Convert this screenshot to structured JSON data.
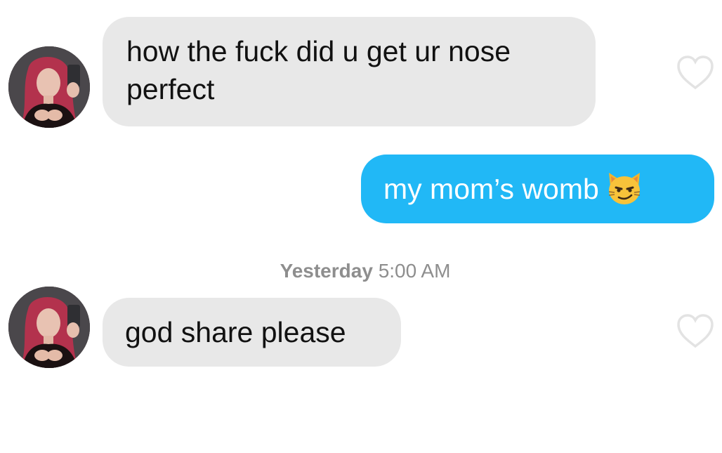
{
  "thread": {
    "top_cut_text": "",
    "messages": [
      {
        "direction": "received",
        "text": "how the fuck did u get ur nose perfect",
        "line1": "how the fuck did u get ur nose",
        "line2": "perfect"
      },
      {
        "direction": "sent",
        "text": "my mom’s womb",
        "emoji": "smiling-cat-with-smirk-icon"
      },
      {
        "direction": "received",
        "text": "god share please"
      }
    ],
    "timestamp": {
      "day": "Yesterday",
      "time": "5:00 AM"
    }
  },
  "colors": {
    "received_bubble": "#e8e8e8",
    "sent_bubble": "#21b8f6",
    "timestamp_text": "#8e8e8e",
    "heart_outline": "#e3e3e3"
  },
  "icons": {
    "avatar": "avatar-icon",
    "like": "heart-outline-icon",
    "emoji": "smirking-cat-icon"
  }
}
